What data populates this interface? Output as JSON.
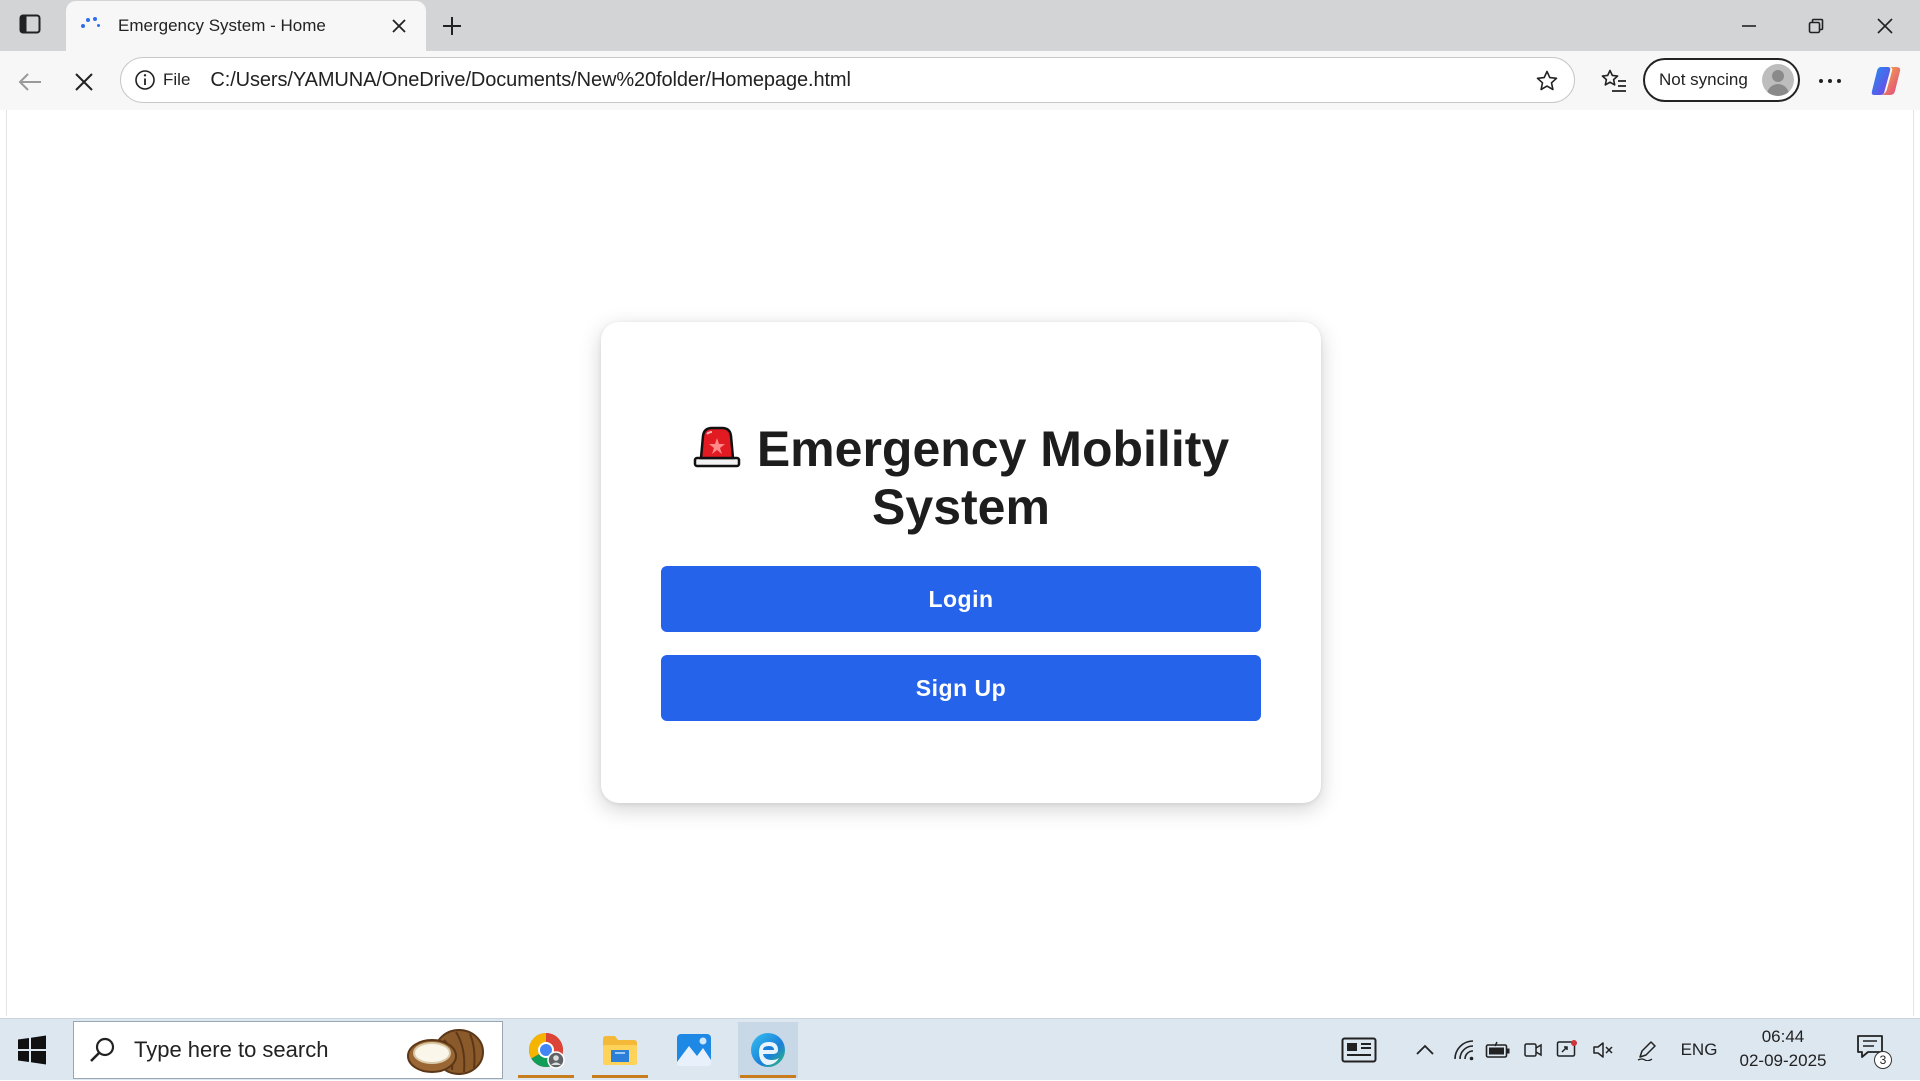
{
  "browser": {
    "tab_title": "Emergency System - Home",
    "address_scheme": "File",
    "address_url": "C:/Users/YAMUNA/OneDrive/Documents/New%20folder/Homepage.html",
    "profile_label": "Not syncing"
  },
  "page": {
    "title": "Emergency Mobility System",
    "title_icon": "siren-icon",
    "login_label": "Login",
    "signup_label": "Sign Up",
    "accent_color": "#2563eb"
  },
  "taskbar": {
    "search_placeholder": "Type here to search",
    "language": "ENG",
    "time": "06:44",
    "date": "02-09-2025",
    "notification_count": "3",
    "apps": [
      "chrome-icon",
      "file-explorer-icon",
      "photos-icon",
      "edge-icon"
    ]
  }
}
